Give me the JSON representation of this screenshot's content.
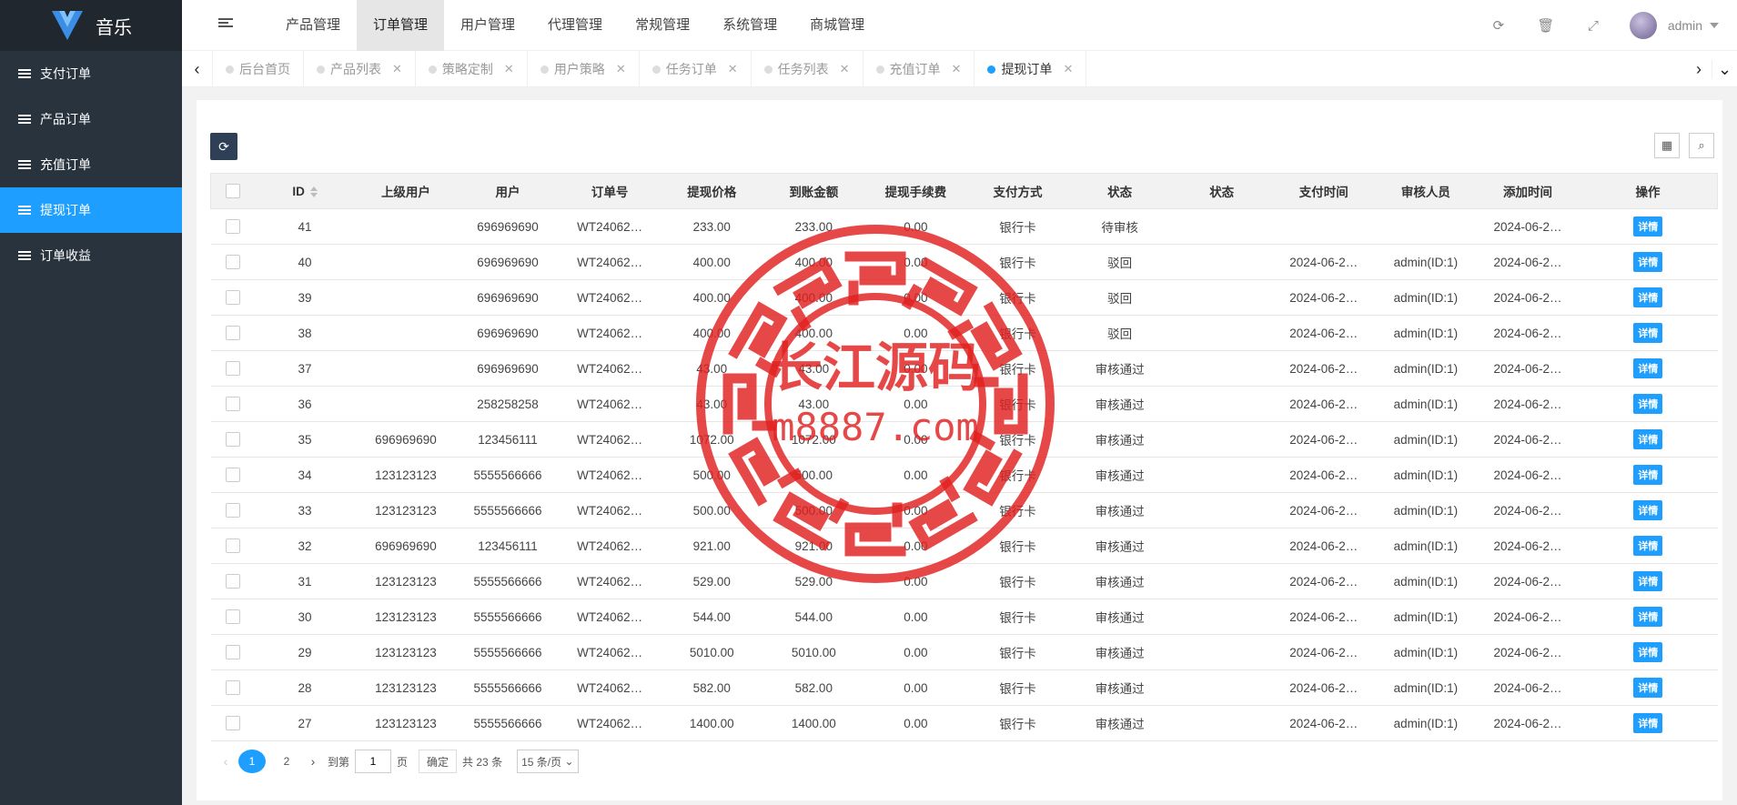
{
  "app": {
    "name": "音乐"
  },
  "sidebar": {
    "items": [
      {
        "label": "支付订单",
        "active": false
      },
      {
        "label": "产品订单",
        "active": false
      },
      {
        "label": "充值订单",
        "active": false
      },
      {
        "label": "提现订单",
        "active": true
      },
      {
        "label": "订单收益",
        "active": false
      }
    ]
  },
  "header": {
    "nav": [
      {
        "label": "产品管理",
        "active": false
      },
      {
        "label": "订单管理",
        "active": true
      },
      {
        "label": "用户管理",
        "active": false
      },
      {
        "label": "代理管理",
        "active": false
      },
      {
        "label": "常规管理",
        "active": false
      },
      {
        "label": "系统管理",
        "active": false
      },
      {
        "label": "商城管理",
        "active": false
      }
    ],
    "user": "admin"
  },
  "tabs": [
    {
      "label": "后台首页",
      "active": false,
      "closable": false
    },
    {
      "label": "产品列表",
      "active": false,
      "closable": true
    },
    {
      "label": "策略定制",
      "active": false,
      "closable": true
    },
    {
      "label": "用户策略",
      "active": false,
      "closable": true
    },
    {
      "label": "任务订单",
      "active": false,
      "closable": true
    },
    {
      "label": "任务列表",
      "active": false,
      "closable": true
    },
    {
      "label": "充值订单",
      "active": false,
      "closable": true
    },
    {
      "label": "提现订单",
      "active": true,
      "closable": true
    }
  ],
  "table": {
    "columns": [
      "ID",
      "上级用户",
      "用户",
      "订单号",
      "提现价格",
      "到账金额",
      "提现手续费",
      "支付方式",
      "状态",
      "状态",
      "支付时间",
      "审核人员",
      "添加时间",
      "操作"
    ],
    "action_label": "详情",
    "rows": [
      [
        "41",
        "",
        "696969690",
        "WT24062…",
        "233.00",
        "233.00",
        "0.00",
        "银行卡",
        "待审核",
        "",
        "",
        "",
        "2024-06-2…"
      ],
      [
        "40",
        "",
        "696969690",
        "WT24062…",
        "400.00",
        "400.00",
        "0.00",
        "银行卡",
        "驳回",
        "",
        "2024-06-2…",
        "admin(ID:1)",
        "2024-06-2…"
      ],
      [
        "39",
        "",
        "696969690",
        "WT24062…",
        "400.00",
        "400.00",
        "0.00",
        "银行卡",
        "驳回",
        "",
        "2024-06-2…",
        "admin(ID:1)",
        "2024-06-2…"
      ],
      [
        "38",
        "",
        "696969690",
        "WT24062…",
        "400.00",
        "400.00",
        "0.00",
        "银行卡",
        "驳回",
        "",
        "2024-06-2…",
        "admin(ID:1)",
        "2024-06-2…"
      ],
      [
        "37",
        "",
        "696969690",
        "WT24062…",
        "43.00",
        "43.00",
        "0.00",
        "银行卡",
        "审核通过",
        "",
        "2024-06-2…",
        "admin(ID:1)",
        "2024-06-2…"
      ],
      [
        "36",
        "",
        "258258258",
        "WT24062…",
        "43.00",
        "43.00",
        "0.00",
        "银行卡",
        "审核通过",
        "",
        "2024-06-2…",
        "admin(ID:1)",
        "2024-06-2…"
      ],
      [
        "35",
        "696969690",
        "123456111",
        "WT24062…",
        "1072.00",
        "1072.00",
        "0.00",
        "银行卡",
        "审核通过",
        "",
        "2024-06-2…",
        "admin(ID:1)",
        "2024-06-2…"
      ],
      [
        "34",
        "123123123",
        "5555566666",
        "WT24062…",
        "500.00",
        "500.00",
        "0.00",
        "银行卡",
        "审核通过",
        "",
        "2024-06-2…",
        "admin(ID:1)",
        "2024-06-2…"
      ],
      [
        "33",
        "123123123",
        "5555566666",
        "WT24062…",
        "500.00",
        "500.00",
        "0.00",
        "银行卡",
        "审核通过",
        "",
        "2024-06-2…",
        "admin(ID:1)",
        "2024-06-2…"
      ],
      [
        "32",
        "696969690",
        "123456111",
        "WT24062…",
        "921.00",
        "921.00",
        "0.00",
        "银行卡",
        "审核通过",
        "",
        "2024-06-2…",
        "admin(ID:1)",
        "2024-06-2…"
      ],
      [
        "31",
        "123123123",
        "5555566666",
        "WT24062…",
        "529.00",
        "529.00",
        "0.00",
        "银行卡",
        "审核通过",
        "",
        "2024-06-2…",
        "admin(ID:1)",
        "2024-06-2…"
      ],
      [
        "30",
        "123123123",
        "5555566666",
        "WT24062…",
        "544.00",
        "544.00",
        "0.00",
        "银行卡",
        "审核通过",
        "",
        "2024-06-2…",
        "admin(ID:1)",
        "2024-06-2…"
      ],
      [
        "29",
        "123123123",
        "5555566666",
        "WT24062…",
        "5010.00",
        "5010.00",
        "0.00",
        "银行卡",
        "审核通过",
        "",
        "2024-06-2…",
        "admin(ID:1)",
        "2024-06-2…"
      ],
      [
        "28",
        "123123123",
        "5555566666",
        "WT24062…",
        "582.00",
        "582.00",
        "0.00",
        "银行卡",
        "审核通过",
        "",
        "2024-06-2…",
        "admin(ID:1)",
        "2024-06-2…"
      ],
      [
        "27",
        "123123123",
        "5555566666",
        "WT24062…",
        "1400.00",
        "1400.00",
        "0.00",
        "银行卡",
        "审核通过",
        "",
        "2024-06-2…",
        "admin(ID:1)",
        "2024-06-2…"
      ]
    ]
  },
  "pager": {
    "pages": [
      "1",
      "2"
    ],
    "current": "1",
    "goto_prefix": "到第",
    "goto_value": "1",
    "goto_suffix": "页",
    "confirm_label": "确定",
    "total_text": "共 23 条",
    "page_size": "15 条/页"
  },
  "watermark": {
    "line1": "长江源码",
    "line2": "m8887.com",
    "color": "#e02020"
  },
  "colors": {
    "sidebar_bg": "#28333e",
    "accent": "#1e9fff",
    "dark_button": "#2f4056"
  }
}
